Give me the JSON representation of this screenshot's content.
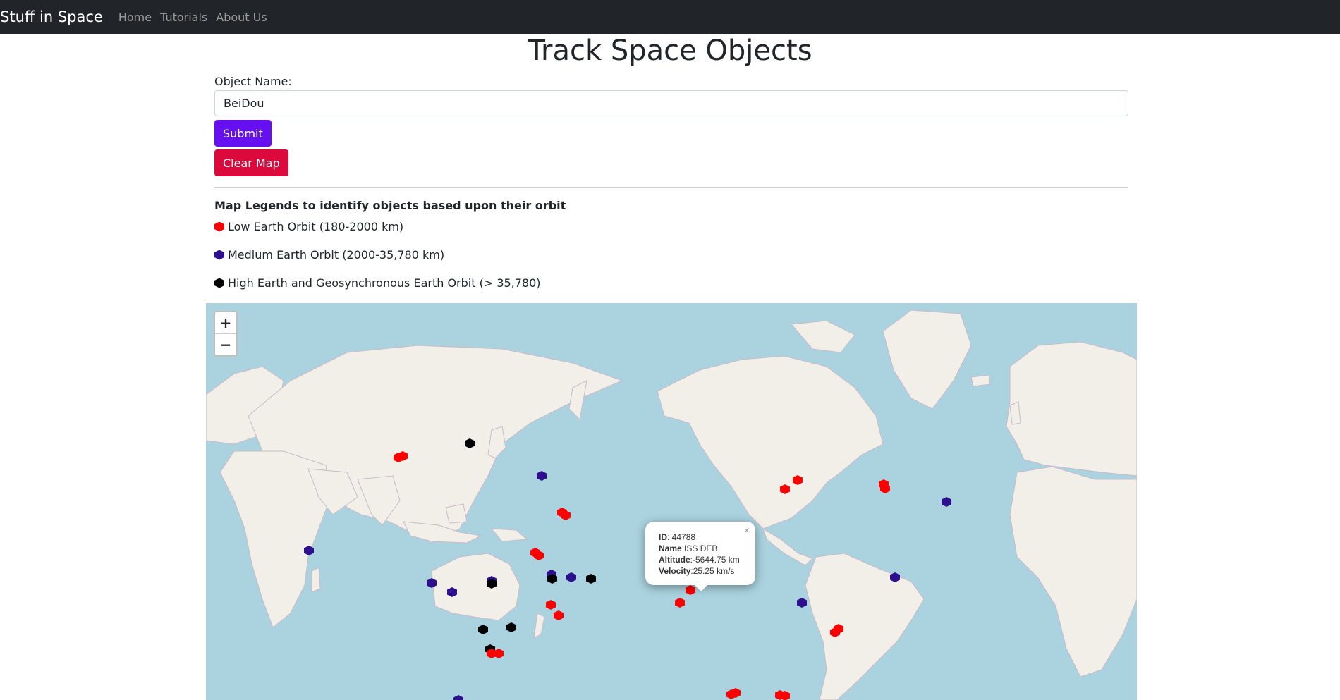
{
  "navbar": {
    "brand": "Stuff in Space",
    "links": [
      "Home",
      "Tutorials",
      "About Us"
    ]
  },
  "page_title": "Track Space Objects",
  "form": {
    "label": "Object Name:",
    "value": "BeiDou",
    "submit_label": "Submit",
    "clear_label": "Clear Map"
  },
  "legend": {
    "title": "Map Legends to identify objects based upon their orbit",
    "items": [
      {
        "label": "Low Earth Orbit (180-2000 km)",
        "color": "#ff0000"
      },
      {
        "label": "Medium Earth Orbit (2000-35,780 km)",
        "color": "#2e0f8e"
      },
      {
        "label": "High Earth and Geosynchronous Earth Orbit (> 35,780)",
        "color": "#000000"
      }
    ]
  },
  "map": {
    "zoom_in": "+",
    "zoom_out": "−",
    "popup": {
      "id_label": "ID",
      "id": "44788",
      "name_label": "Name",
      "name": "ISS DEB",
      "altitude_label": "Altitude",
      "altitude": "-5644.75 km",
      "velocity_label": "Velocity",
      "velocity": "25.25 km/s",
      "close": "×"
    },
    "colors": {
      "ocean": "#aad3df",
      "land": "#f2efe9",
      "leo": "#ff0000",
      "meo": "#2e0f8e",
      "heo": "#000000"
    }
  }
}
